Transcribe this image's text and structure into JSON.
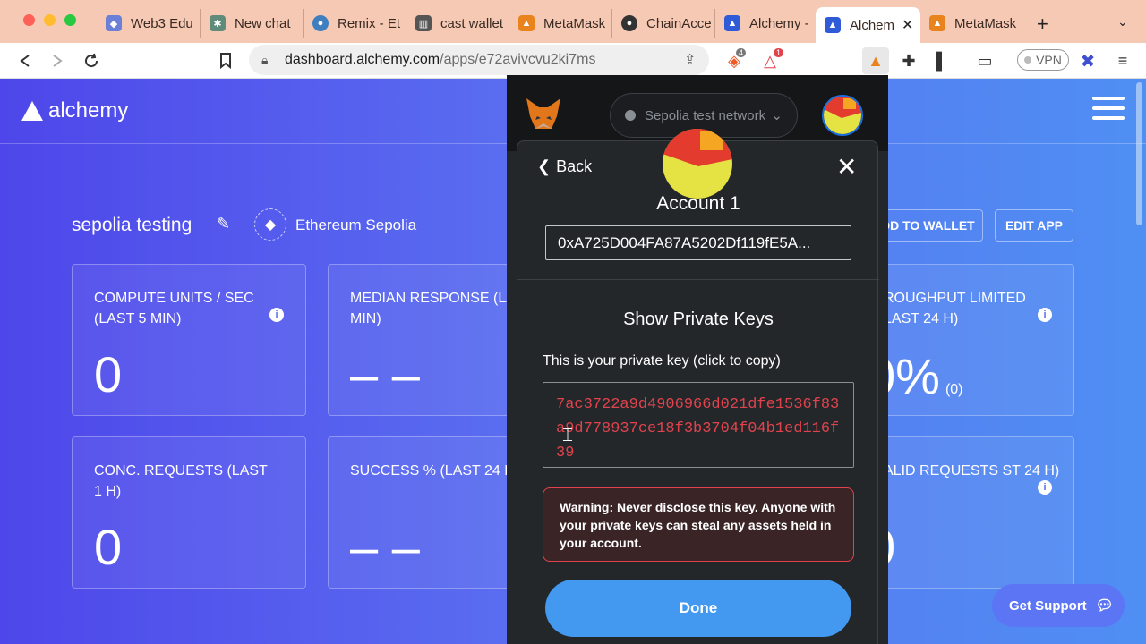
{
  "browser": {
    "tabs": [
      {
        "label": "Web3 Edu",
        "favicon": "globe"
      },
      {
        "label": "New chat",
        "favicon": "chat"
      },
      {
        "label": "Remix - Et",
        "favicon": "remix"
      },
      {
        "label": "cast wallet",
        "favicon": "book"
      },
      {
        "label": "MetaMask",
        "favicon": "fox"
      },
      {
        "label": "ChainAcce",
        "favicon": "github"
      },
      {
        "label": "Alchemy -",
        "favicon": "alchemy"
      },
      {
        "label": "Alchem",
        "favicon": "alchemy",
        "active": true
      },
      {
        "label": "MetaMask",
        "favicon": "fox"
      }
    ],
    "url": {
      "host": "dashboard.alchemy.com",
      "path": "/apps/e72avivcvu2ki7ms"
    },
    "vpn_label": "VPN",
    "brave_badge": "4",
    "alert_badge": "1"
  },
  "dashboard": {
    "logo_text": "alchemy",
    "app_name": "sepolia testing",
    "network": "Ethereum Sepolia",
    "buttons": {
      "add_to_wallet": "DD TO WALLET",
      "edit_app": "EDIT APP"
    },
    "cards": [
      {
        "title": "COMPUTE UNITS / SEC (LAST 5 MIN)",
        "value": "0"
      },
      {
        "title": "MEDIAN RESPONSE (LA 5 MIN)",
        "value": "– –"
      },
      {
        "title": "ROUGHPUT LIMITED LAST 24 H)",
        "value": "0%",
        "sub": "(0)"
      },
      {
        "title": "CONC. REQUESTS (LAST 1 H)",
        "value": "0"
      },
      {
        "title": "SUCCESS % (LAST 24 H",
        "value": "– –"
      },
      {
        "title": "ALID REQUESTS ST 24 H)",
        "value": "0"
      }
    ],
    "support_label": "Get Support"
  },
  "metamask": {
    "network": "Sepolia test network",
    "back_label": "Back",
    "account_name": "Account 1",
    "address": "0xA725D004FA87A5202Df119fE5A...",
    "section_title": "Show Private Keys",
    "pk_label": "This is your private key (click to copy)",
    "private_key": "7ac3722a9d4906966d021dfe1536f83a9d778937ce18f3b3704f04b1ed116f39",
    "warning": "Warning: Never disclose this key. Anyone with your private keys can steal any assets held in your account.",
    "done_label": "Done"
  },
  "colors": {
    "accent": "#4399f0",
    "danger": "#e0434d",
    "metamask_bg": "#24272a"
  }
}
